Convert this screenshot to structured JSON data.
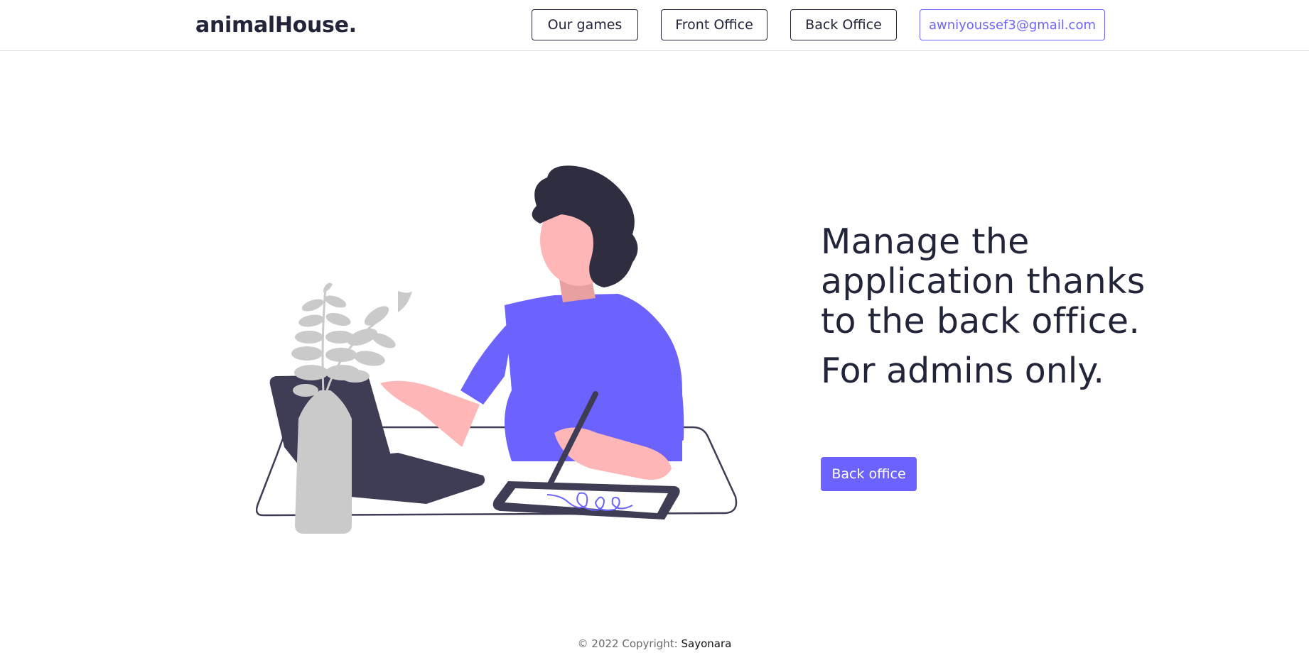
{
  "navbar": {
    "brand": "animalHouse.",
    "links": {
      "our_games": "Our games",
      "front_office": "Front Office",
      "back_office": "Back Office"
    },
    "user_email": "awniyoussef3@gmail.com"
  },
  "hero": {
    "illustration_icon": "woman-working-at-desk-illustration",
    "title": "Manage the application thanks to the back office.",
    "subtitle": "For admins only.",
    "cta_label": "Back office"
  },
  "footer": {
    "copyright_prefix": "© 2022 Copyright:",
    "owner": "Sayonara"
  },
  "colors": {
    "accent": "#6c63ff",
    "text_dark": "#22253a",
    "skin": "#ffb6b6",
    "plant_gray": "#cacaca",
    "laptop": "#3f3d56"
  }
}
